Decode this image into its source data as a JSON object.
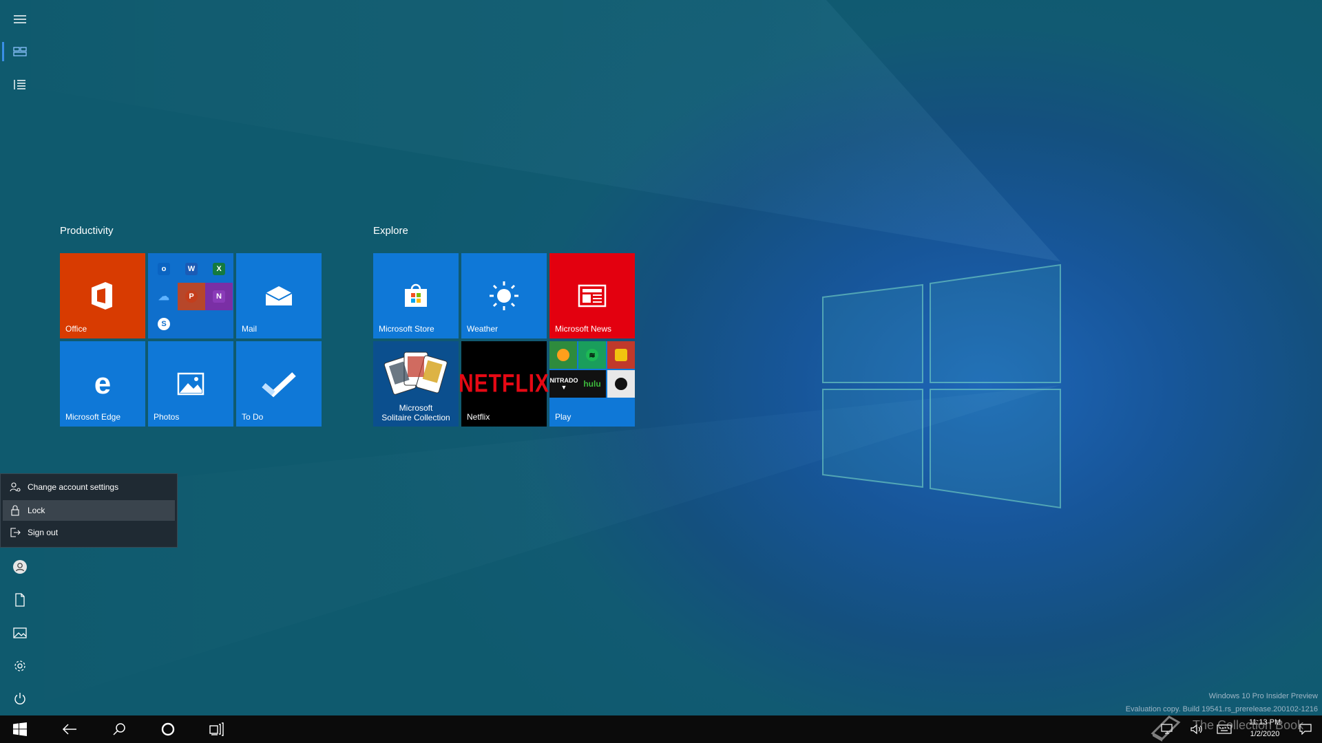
{
  "desktop": {
    "watermark_line1": "Windows 10 Pro Insider Preview",
    "watermark_line2": "Evaluation copy. Build 19541.rs_prerelease.200102-1216",
    "overlay_text": "The Collection Book"
  },
  "start": {
    "groups": [
      {
        "title": "Productivity",
        "tiles": [
          {
            "label": "Office",
            "color": "#d83b01",
            "icon": "office-icon"
          },
          {
            "label": "",
            "color": "#0f6fcc",
            "icon": "office-apps-folder-icon",
            "apps": [
              "Outlook",
              "Word",
              "Excel",
              "OneDrive",
              "PowerPoint",
              "OneNote",
              "Skype"
            ]
          },
          {
            "label": "Mail",
            "color": "#0f78d7",
            "icon": "mail-icon"
          },
          {
            "label": "Microsoft Edge",
            "color": "#0f78d7",
            "icon": "edge-icon"
          },
          {
            "label": "Photos",
            "color": "#0f78d7",
            "icon": "photos-icon"
          },
          {
            "label": "To Do",
            "color": "#0f78d7",
            "icon": "checkmark-icon"
          }
        ]
      },
      {
        "title": "Explore",
        "tiles": [
          {
            "label": "Microsoft Store",
            "color": "#0f78d7",
            "icon": "store-icon"
          },
          {
            "label": "Weather",
            "color": "#0f78d7",
            "icon": "sun-icon"
          },
          {
            "label": "Microsoft News",
            "color": "#e3000f",
            "icon": "news-icon"
          },
          {
            "label": "Microsoft Solitaire Collection",
            "label_line1": "Microsoft",
            "label_line2": "Solitaire Collection",
            "color": "#0b4f8e",
            "icon": "cards-icon"
          },
          {
            "label": "Netflix",
            "color": "#000000",
            "icon": "netflix-logo",
            "logo_text": "NETFLIX"
          },
          {
            "label": "Play",
            "color": "#0f78d7",
            "icon": "play-folder-icon",
            "apps": [
              "NITRADO",
              "hulu"
            ]
          }
        ]
      }
    ]
  },
  "account_menu": {
    "items": [
      {
        "label": "Change account settings",
        "icon": "account-settings-icon"
      },
      {
        "label": "Lock",
        "icon": "lock-icon",
        "hover": true
      },
      {
        "label": "Sign out",
        "icon": "sign-out-icon"
      }
    ]
  },
  "rail": {
    "top": [
      "hamburger-icon",
      "pinned-tiles-icon",
      "all-apps-list-icon"
    ],
    "bottom": [
      "user-avatar-icon",
      "documents-icon",
      "pictures-icon",
      "settings-gear-icon",
      "power-icon"
    ]
  },
  "taskbar": {
    "buttons": [
      "windows-start-icon",
      "back-arrow-icon",
      "search-icon",
      "cortana-circle-icon",
      "task-view-icon"
    ],
    "clock_time": "11:13 PM",
    "clock_date": "1/2/2020"
  },
  "colors": {
    "accent": "#0f78d7",
    "office": "#d83b01",
    "news": "#e3000f",
    "menu_bg": "#1f2a33"
  }
}
